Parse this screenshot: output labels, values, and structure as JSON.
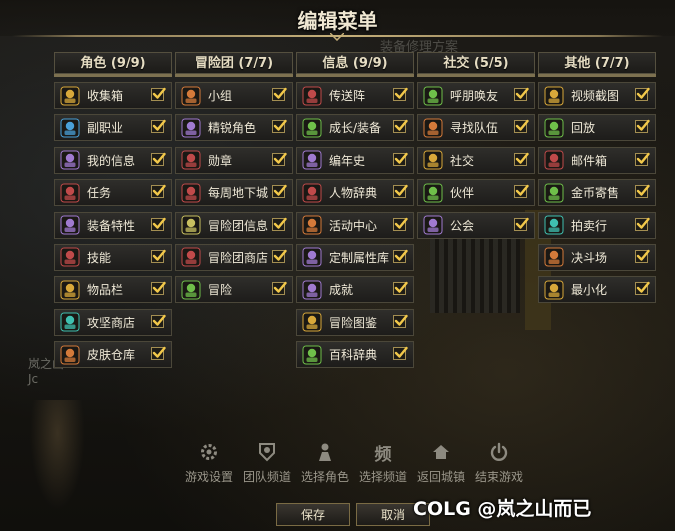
{
  "window": {
    "title": "编辑菜单",
    "ghost_text": "装备修理方案"
  },
  "check_color": "#f2c84a",
  "columns": [
    {
      "header": "角色 (9/9)",
      "items": [
        {
          "label": "收集箱",
          "icon": "treasure-chest-icon",
          "checked": true
        },
        {
          "label": "副职业",
          "icon": "potion-flask-icon",
          "checked": true
        },
        {
          "label": "我的信息",
          "icon": "character-info-icon",
          "checked": true
        },
        {
          "label": "任务",
          "icon": "quest-scroll-icon",
          "checked": true
        },
        {
          "label": "装备特性",
          "icon": "shield-crest-icon",
          "checked": true
        },
        {
          "label": "技能",
          "icon": "skill-star-icon",
          "checked": true
        },
        {
          "label": "物品栏",
          "icon": "backpack-icon",
          "checked": true
        },
        {
          "label": "攻坚商店",
          "icon": "shop-chest-icon",
          "checked": true
        },
        {
          "label": "皮肤仓库",
          "icon": "paint-brush-icon",
          "checked": true
        }
      ]
    },
    {
      "header": "冒险团 (7/7)",
      "items": [
        {
          "label": "小组",
          "icon": "party-group-icon",
          "checked": true
        },
        {
          "label": "精锐角色",
          "icon": "elite-character-icon",
          "checked": true
        },
        {
          "label": "勋章",
          "icon": "medal-icon",
          "checked": true
        },
        {
          "label": "每周地下城",
          "icon": "dungeon-gate-icon",
          "checked": true
        },
        {
          "label": "冒险团信息",
          "icon": "banner-icon",
          "checked": true
        },
        {
          "label": "冒险团商店",
          "icon": "guild-shop-icon",
          "checked": true
        },
        {
          "label": "冒险",
          "icon": "adventure-flag-icon",
          "checked": true
        }
      ]
    },
    {
      "header": "信息 (9/9)",
      "items": [
        {
          "label": "传送阵",
          "icon": "teleport-portal-icon",
          "checked": true
        },
        {
          "label": "成长/装备",
          "icon": "growth-star-icon",
          "checked": true
        },
        {
          "label": "编年史",
          "icon": "chronicle-gear-icon",
          "checked": true
        },
        {
          "label": "人物辞典",
          "icon": "character-dictionary-icon",
          "checked": true
        },
        {
          "label": "活动中心",
          "icon": "event-checklist-icon",
          "checked": true
        },
        {
          "label": "定制属性库",
          "icon": "custom-book-icon",
          "checked": true
        },
        {
          "label": "成就",
          "icon": "achievement-scroll-icon",
          "checked": true
        },
        {
          "label": "冒险图鉴",
          "icon": "adventure-codex-icon",
          "checked": true
        },
        {
          "label": "百科辞典",
          "icon": "encyclopedia-icon",
          "checked": true
        }
      ]
    },
    {
      "header": "社交 (5/5)",
      "items": [
        {
          "label": "呼朋唤友",
          "icon": "call-friends-icon",
          "checked": true
        },
        {
          "label": "寻找队伍",
          "icon": "find-party-icon",
          "checked": true
        },
        {
          "label": "社交",
          "icon": "social-badge-icon",
          "checked": true
        },
        {
          "label": "伙伴",
          "icon": "handshake-icon",
          "checked": true
        },
        {
          "label": "公会",
          "icon": "guild-emblem-icon",
          "checked": true
        }
      ]
    },
    {
      "header": "其他 (7/7)",
      "items": [
        {
          "label": "视频截图",
          "icon": "camera-icon",
          "checked": true
        },
        {
          "label": "回放",
          "icon": "replay-film-icon",
          "checked": true
        },
        {
          "label": "邮件箱",
          "icon": "mail-envelope-icon",
          "checked": true
        },
        {
          "label": "金币寄售",
          "icon": "gold-coin-icon",
          "checked": true
        },
        {
          "label": "拍卖行",
          "icon": "auction-gavel-icon",
          "checked": true
        },
        {
          "label": "决斗场",
          "icon": "crossed-swords-icon",
          "checked": true
        },
        {
          "label": "最小化",
          "icon": "minimize-icon",
          "checked": true
        }
      ]
    }
  ],
  "bottom_menu": [
    {
      "label": "游戏设置",
      "icon": "gear-icon"
    },
    {
      "label": "团队频道",
      "icon": "team-channel-icon"
    },
    {
      "label": "选择角色",
      "icon": "select-character-icon"
    },
    {
      "label": "选择频道",
      "icon": "channel-icon",
      "glyph": "频"
    },
    {
      "label": "返回城镇",
      "icon": "home-icon"
    },
    {
      "label": "结束游戏",
      "icon": "power-icon"
    }
  ],
  "buttons": {
    "confirm": "保存",
    "cancel": "取消"
  },
  "watermark": "COLG @岚之山而已",
  "character": {
    "name": "岚之山",
    "sub": "Jc"
  }
}
